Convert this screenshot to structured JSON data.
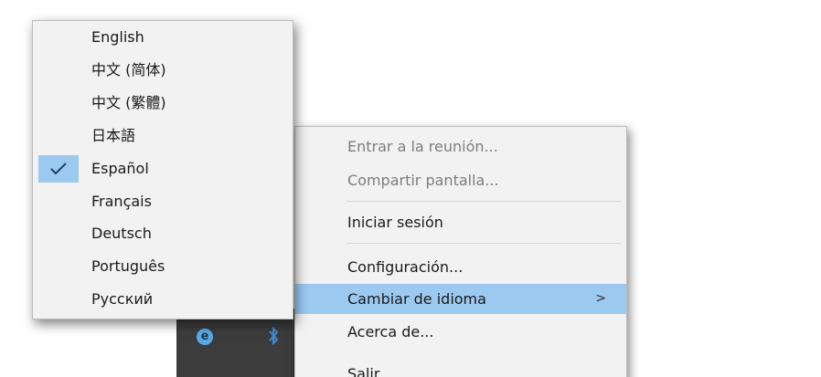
{
  "language_menu": {
    "items": [
      {
        "label": "English",
        "checked": false
      },
      {
        "label": "中文 (简体)",
        "checked": false
      },
      {
        "label": "中文 (繁體)",
        "checked": false
      },
      {
        "label": "日本語",
        "checked": false
      },
      {
        "label": "Español",
        "checked": true
      },
      {
        "label": "Français",
        "checked": false
      },
      {
        "label": "Deutsch",
        "checked": false
      },
      {
        "label": "Português",
        "checked": false
      },
      {
        "label": "Русский",
        "checked": false
      }
    ]
  },
  "context_menu": {
    "items": [
      {
        "label": "Entrar a la reunión...",
        "disabled": true
      },
      {
        "label": "Compartir pantalla...",
        "disabled": true
      },
      {
        "label": "Iniciar sesión",
        "disabled": false
      },
      {
        "label": "Configuración...",
        "disabled": false
      },
      {
        "label": "Cambiar de idioma",
        "disabled": false,
        "submenu_arrow": ">"
      },
      {
        "label": "Acerca de...",
        "disabled": false
      },
      {
        "label": "Salir",
        "disabled": false
      }
    ]
  },
  "tray": {
    "icons": [
      "browser-icon",
      "bluetooth-icon"
    ],
    "browser_glyph": "e"
  },
  "colors": {
    "menu_background": "#f2f2f2",
    "highlight": "#9cc9f0",
    "disabled_text": "#7d7d7d",
    "tray_background": "#3c3c3c"
  }
}
